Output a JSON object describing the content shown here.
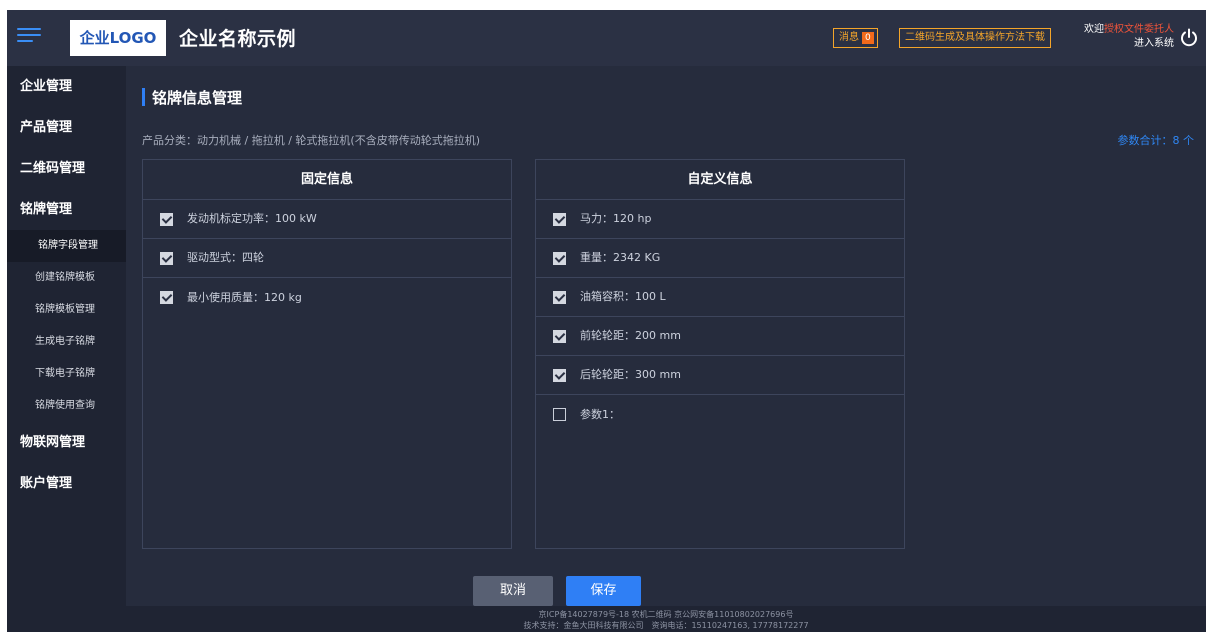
{
  "header": {
    "logo": "企业LOGO",
    "company_name": "企业名称示例",
    "message_label": "消息",
    "message_count": "0",
    "qr_download_label": "二维码生成及具体操作方法下载",
    "welcome_prefix": "欢迎",
    "welcome_user": "授权文件委托人",
    "enter_system": "进入系统"
  },
  "sidebar": {
    "group1": "企业管理",
    "group2": "产品管理",
    "group3": "二维码管理",
    "group4": "铭牌管理",
    "sub": [
      "铭牌字段管理",
      "创建铭牌模板",
      "铭牌模板管理",
      "生成电子铭牌",
      "下载电子铭牌",
      "铭牌使用查询"
    ],
    "group5": "物联网管理",
    "group6": "账户管理"
  },
  "main": {
    "title": "铭牌信息管理",
    "breadcrumb": "产品分类：动力机械 / 拖拉机 / 轮式拖拉机(不含皮带传动轮式拖拉机)",
    "param_total": "参数合计：8 个",
    "fixed_title": "固定信息",
    "fixed_rows": [
      "发动机标定功率：100 kW",
      "驱动型式：四轮",
      "最小使用质量：120 kg"
    ],
    "custom_title": "自定义信息",
    "custom_rows": [
      "马力：120 hp",
      "重量：2342 KG",
      "油箱容积：100 L",
      "前轮轮距：200 mm",
      "后轮轮距：300 mm",
      "参数1："
    ],
    "cancel_label": "取消",
    "save_label": "保存"
  },
  "footer": {
    "line1": "京ICP备14027879号-18 农机二维码 京公网安备11010802027696号",
    "line2": "技术支持：金鱼大田科技有限公司　资询电话：15110247163, 17778172277"
  },
  "colors": {
    "accent": "#2f7ff5",
    "warning": "#f4a52a",
    "background": "#1f2433"
  }
}
